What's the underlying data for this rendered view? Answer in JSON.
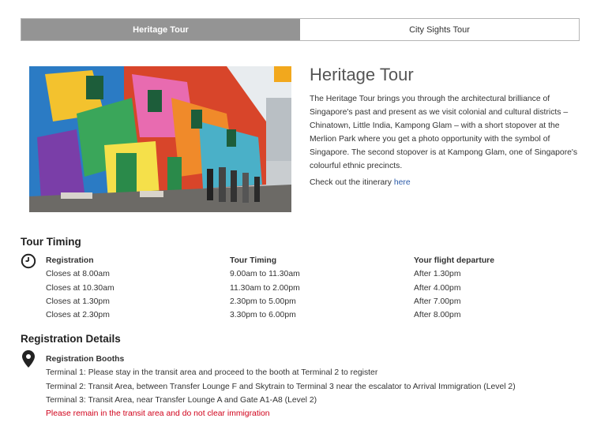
{
  "tabs": [
    {
      "label": "Heritage Tour",
      "active": true
    },
    {
      "label": "City Sights Tour",
      "active": false
    }
  ],
  "tour": {
    "title": "Heritage Tour",
    "description": "The Heritage Tour brings you through the architectural brilliance of Singapore's past and present as we visit colonial and cultural districts – Chinatown, Little India, Kampong Glam – with a short stopover at the Merlion Park where you get a photo opportunity with the symbol of Singapore. The second stopover is at Kampong Glam, one of Singapore's colourful ethnic precincts.",
    "itinerary_text": "Check out the itinerary ",
    "itinerary_link": "here"
  },
  "timing": {
    "heading": "Tour Timing",
    "icon": "clock-icon",
    "registration": {
      "header": "Registration",
      "rows": [
        "Closes at 8.00am",
        "Closes at 10.30am",
        "Closes at 1.30pm",
        "Closes at 2.30pm"
      ]
    },
    "tour_timing": {
      "header": "Tour Timing",
      "rows": [
        "9.00am to 11.30am",
        "11.30am to 2.00pm",
        "2.30pm to 5.00pm",
        "3.30pm to 6.00pm"
      ]
    },
    "flight": {
      "header": "Your flight departure",
      "rows": [
        "After 1.30pm",
        "After 4.00pm",
        "After 7.00pm",
        "After 8.00pm"
      ]
    }
  },
  "registration": {
    "heading": "Registration Details",
    "icon": "map-pin-icon",
    "booths_header": "Registration Booths",
    "lines": [
      "Terminal 1: Please stay in the transit area and proceed to the booth at Terminal 2 to register",
      "Terminal 2: Transit Area, between Transfer Lounge F and Skytrain to Terminal 3 near the escalator to Arrival Immigration (Level 2)",
      "Terminal 3: Transit Area, near Transfer Lounge A and Gate A1-A8 (Level 2)"
    ],
    "warning": "Please remain in the transit area and do not clear immigration"
  },
  "colors": {
    "tab_active": "#949494",
    "link": "#2a5aa8",
    "warning": "#d0021b"
  }
}
